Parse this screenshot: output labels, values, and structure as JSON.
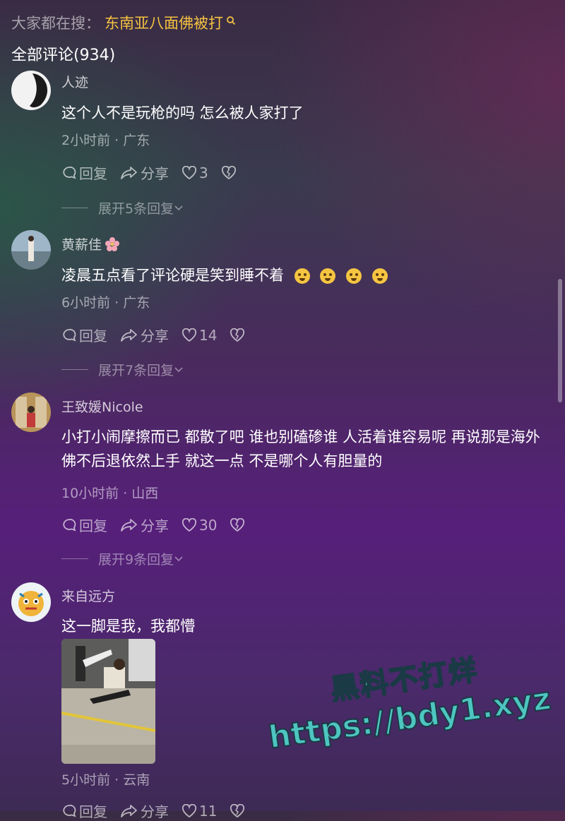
{
  "search": {
    "prefix": "大家都在搜：",
    "term": "东南亚八面佛被打"
  },
  "comments_header": "全部评论(934)",
  "comments": [
    {
      "username": "人迹",
      "text": "这个人不是玩枪的吗 怎么被人家打了",
      "time_location": "2小时前 · 广东",
      "reply_label": "回复",
      "share_label": "分享",
      "likes": "3",
      "expand_label": "展开5条回复"
    },
    {
      "username": "黄薪佳",
      "text": "凌晨五点看了评论硬是笑到睡不着",
      "time_location": "6小时前 · 广东",
      "reply_label": "回复",
      "share_label": "分享",
      "likes": "14",
      "expand_label": "展开7条回复"
    },
    {
      "username": "王致媛Nicole",
      "text": "小打小闹摩擦而已 都散了吧 谁也别磕碜谁 人活着谁容易呢 再说那是海外 佛不后退依然上手 就这一点 不是哪个人有胆量的",
      "time_location": "10小时前 · 山西",
      "reply_label": "回复",
      "share_label": "分享",
      "likes": "30",
      "expand_label": "展开9条回复"
    },
    {
      "username": "来自远方",
      "text": "这一脚是我，我都懵",
      "time_location": "5小时前 · 云南",
      "reply_label": "回复",
      "share_label": "分享",
      "likes": "11"
    }
  ],
  "watermark": {
    "line1": "黑料不打烊",
    "line2": "https://bdy1.xyz"
  },
  "colors": {
    "accent": "#f5c242",
    "watermark": "#4ec5c1"
  }
}
